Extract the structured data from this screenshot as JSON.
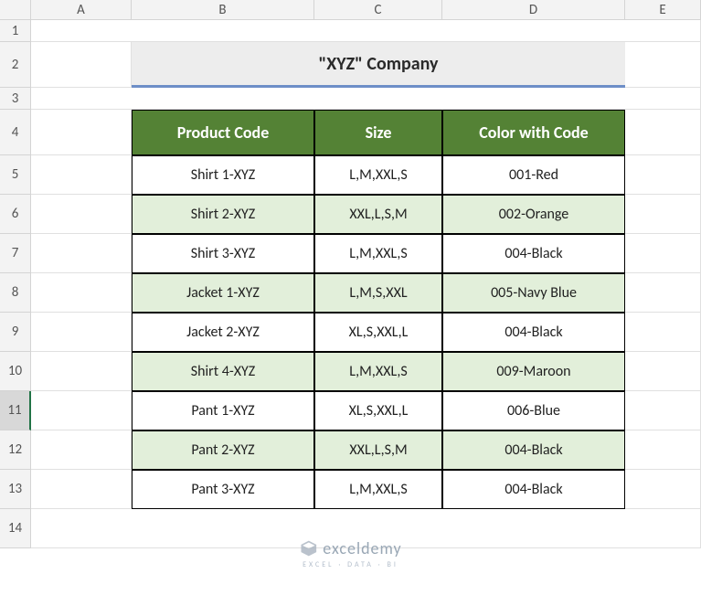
{
  "columns": [
    "A",
    "B",
    "C",
    "D",
    "E"
  ],
  "row_labels": [
    "1",
    "2",
    "3",
    "4",
    "5",
    "6",
    "7",
    "8",
    "9",
    "10",
    "11",
    "12",
    "13",
    "14"
  ],
  "selected_row": "11",
  "title": "\"XYZ\" Company",
  "table": {
    "headers": [
      "Product Code",
      "Size",
      "Color with Code"
    ],
    "rows": [
      {
        "product": "Shirt 1-XYZ",
        "size": "L,M,XXL,S",
        "color": "001-Red"
      },
      {
        "product": "Shirt 2-XYZ",
        "size": "XXL,L,S,M",
        "color": "002-Orange"
      },
      {
        "product": "Shirt 3-XYZ",
        "size": "L,M,XXL,S",
        "color": "004-Black"
      },
      {
        "product": "Jacket 1-XYZ",
        "size": "L,M,S,XXL",
        "color": "005-Navy Blue"
      },
      {
        "product": "Jacket 2-XYZ",
        "size": "XL,S,XXL,L",
        "color": "004-Black"
      },
      {
        "product": "Shirt 4-XYZ",
        "size": "L,M,XXL,S",
        "color": "009-Maroon"
      },
      {
        "product": "Pant 1-XYZ",
        "size": "XL,S,XXL,L",
        "color": "006-Blue"
      },
      {
        "product": "Pant 2-XYZ",
        "size": "XXL,L,S,M",
        "color": "004-Black"
      },
      {
        "product": "Pant 3-XYZ",
        "size": "L,M,XXL,S",
        "color": "004-Black"
      }
    ]
  },
  "watermark": {
    "main": "exceldemy",
    "sub": "EXCEL · DATA · BI"
  },
  "chart_data": {
    "type": "table",
    "title": "\"XYZ\" Company",
    "headers": [
      "Product Code",
      "Size",
      "Color with Code"
    ],
    "rows": [
      [
        "Shirt 1-XYZ",
        "L,M,XXL,S",
        "001-Red"
      ],
      [
        "Shirt 2-XYZ",
        "XXL,L,S,M",
        "002-Orange"
      ],
      [
        "Shirt 3-XYZ",
        "L,M,XXL,S",
        "004-Black"
      ],
      [
        "Jacket 1-XYZ",
        "L,M,S,XXL",
        "005-Navy Blue"
      ],
      [
        "Jacket 2-XYZ",
        "XL,S,XXL,L",
        "004-Black"
      ],
      [
        "Shirt 4-XYZ",
        "L,M,XXL,S",
        "009-Maroon"
      ],
      [
        "Pant 1-XYZ",
        "XL,S,XXL,L",
        "006-Blue"
      ],
      [
        "Pant 2-XYZ",
        "XXL,L,S,M",
        "004-Black"
      ],
      [
        "Pant 3-XYZ",
        "L,M,XXL,S",
        "004-Black"
      ]
    ]
  }
}
